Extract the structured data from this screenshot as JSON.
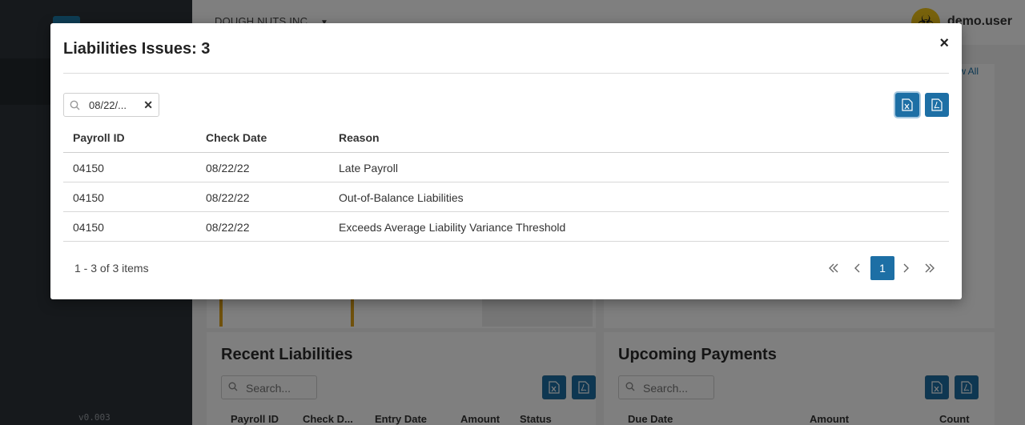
{
  "app": {
    "company": "DOUGH NUTS INC.",
    "username": "demo.user",
    "version": "v0.003",
    "view_all": "View All"
  },
  "background": {
    "recent_liabilities": {
      "title": "Recent Liabilities",
      "search_placeholder": "Search...",
      "columns": [
        "Payroll ID",
        "Check D...",
        "Entry Date",
        "Amount",
        "Status"
      ]
    },
    "upcoming_payments": {
      "title": "Upcoming Payments",
      "search_placeholder": "Search...",
      "columns": [
        "Due Date",
        "Amount",
        "Count"
      ]
    }
  },
  "modal": {
    "title": "Liabilities Issues: 3",
    "close_glyph": "×",
    "filter": {
      "value": "08/22/...",
      "clear_glyph": "✕"
    },
    "export_icons": [
      "excel-export-icon",
      "pdf-export-icon"
    ],
    "columns": [
      "Payroll ID",
      "Check Date",
      "Reason"
    ],
    "rows": [
      {
        "payroll_id": "04150",
        "check_date": "08/22/22",
        "reason": "Late Payroll"
      },
      {
        "payroll_id": "04150",
        "check_date": "08/22/22",
        "reason": "Out-of-Balance Liabilities"
      },
      {
        "payroll_id": "04150",
        "check_date": "08/22/22",
        "reason": "Exceeds Average Liability Variance Threshold"
      }
    ],
    "pager": {
      "info": "1 - 3 of 3 items",
      "current_page": "1"
    }
  },
  "colors": {
    "accent": "#1d6fa5",
    "stat_border": "#e0a319"
  }
}
